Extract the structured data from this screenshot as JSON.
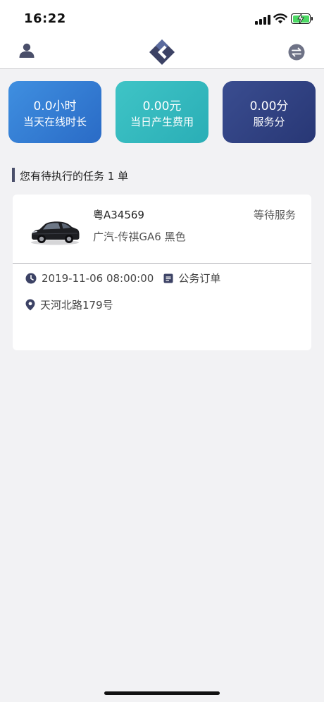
{
  "status_bar": {
    "time": "16:22"
  },
  "header": {
    "user_icon": "person-icon",
    "logo_icon": "app-logo",
    "switch_icon": "switch-arrows-icon"
  },
  "stats": [
    {
      "value": "0.0小时",
      "label": "当天在线时长"
    },
    {
      "value": "0.00元",
      "label": "当日产生费用"
    },
    {
      "value": "0.00分",
      "label": "服务分"
    }
  ],
  "section": {
    "title": "您有待执行的任务 1 单"
  },
  "task": {
    "plate": "粤A34569",
    "status": "等待服务",
    "model": "广汽-传祺GA6 黑色",
    "time": "2019-11-06 08:00:00",
    "order_type": "公务订单",
    "address": "天河北路179号"
  },
  "colors": {
    "card_hours": "#2f7bd4",
    "card_fee": "#35b9bd",
    "card_score": "#2f3f82",
    "accent_dark": "#3c4265"
  }
}
